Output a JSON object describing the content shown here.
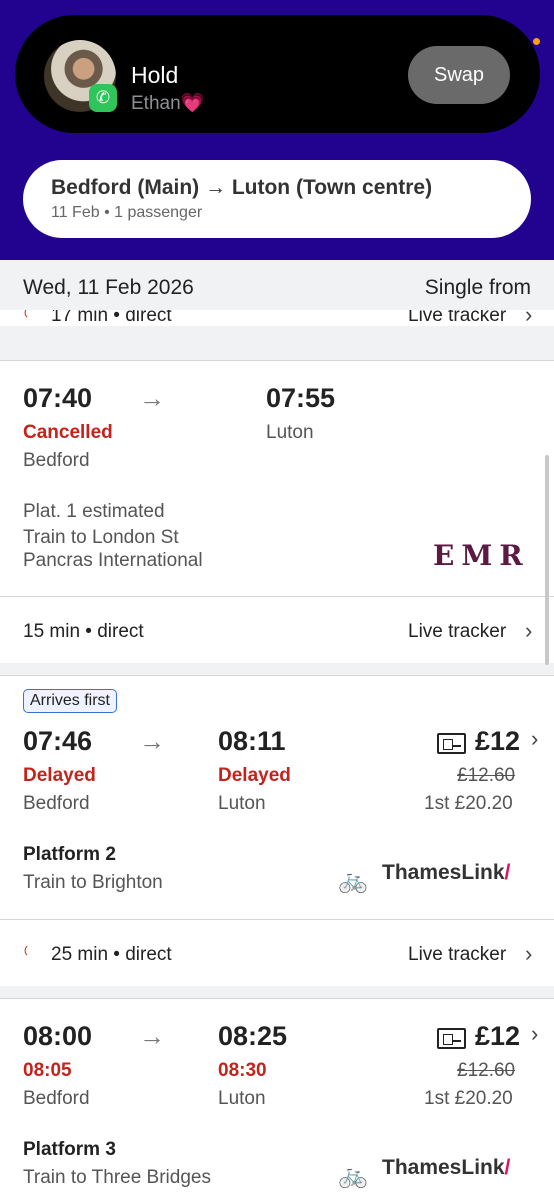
{
  "call": {
    "status": "Hold",
    "caller": "Ethan💗",
    "swap_label": "Swap"
  },
  "search": {
    "route": "Bedford (Main) → Luton (Town centre)",
    "details": "11 Feb • 1 passenger"
  },
  "results": {
    "date": "Wed, 11 Feb 2026",
    "fare_type": "Single from"
  },
  "prev_footer": {
    "duration": "17 min • direct",
    "live_tracker": "Live tracker"
  },
  "journeys": [
    {
      "depart": "07:40",
      "arrive": "07:55",
      "depart_status": "Cancelled",
      "depart_station": "Bedford",
      "arrive_station": "Luton",
      "platform": "Plat. 1 estimated",
      "destination_line1": "Train to London St",
      "destination_line2": "Pancras International",
      "operator": "EMR",
      "duration": "15 min • direct",
      "live_tracker": "Live tracker"
    },
    {
      "badge": "Arrives first",
      "depart": "07:46",
      "arrive": "08:11",
      "depart_status": "Delayed",
      "arrive_status": "Delayed",
      "depart_station": "Bedford",
      "arrive_station": "Luton",
      "price": "£12",
      "old_price": "£12.60",
      "first_class": "1st £20.20",
      "platform": "Platform 2",
      "destination": "Train to Brighton",
      "operator": "ThamesLink",
      "operator_slash": "/",
      "duration": "25 min • direct",
      "live_tracker": "Live tracker"
    },
    {
      "depart": "08:00",
      "arrive": "08:25",
      "depart_status": "08:05",
      "arrive_status": "08:30",
      "depart_station": "Bedford",
      "arrive_station": "Luton",
      "price": "£12",
      "old_price": "£12.60",
      "first_class": "1st £20.20",
      "platform": "Platform 3",
      "destination": "Train to Three Bridges",
      "operator": "ThamesLink",
      "operator_slash": "/"
    }
  ],
  "icons": {
    "arrow": "→",
    "chevron": "›",
    "bike": "🚲",
    "live": "◜",
    "phone": "✆"
  },
  "colors": {
    "header_bg": "#22038f",
    "delay_red": "#c4231c",
    "emr": "#5b1a43",
    "thameslink_accent": "#e0115f"
  }
}
